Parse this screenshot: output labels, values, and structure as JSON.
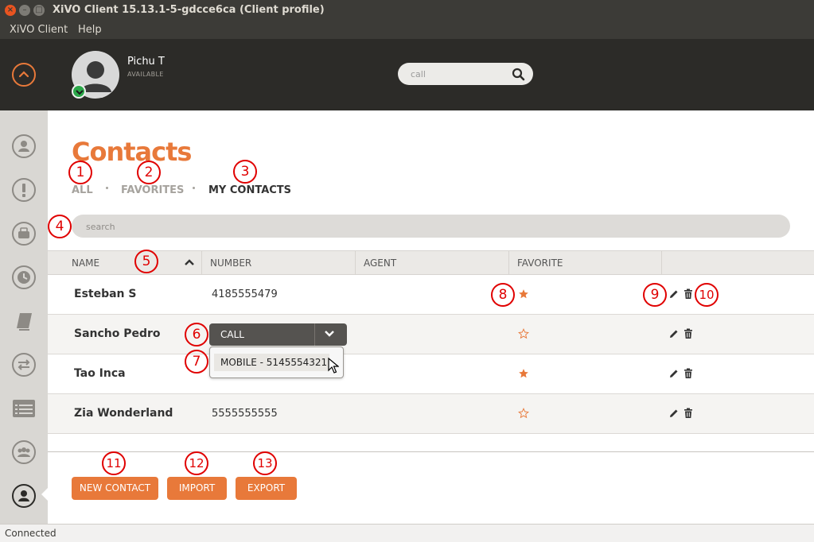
{
  "window": {
    "title": "XiVO Client 15.13.1-5-gdcce6ca (Client profile)",
    "menu": [
      "XiVO Client",
      "Help"
    ]
  },
  "header": {
    "user_name": "Pichu T",
    "user_status": "AVAILABLE",
    "call_placeholder": "call"
  },
  "contacts": {
    "title": "Contacts",
    "tabs": [
      "ALL",
      "FAVORITES",
      "MY CONTACTS"
    ],
    "search_placeholder": "search",
    "columns": [
      "NAME",
      "NUMBER",
      "AGENT",
      "FAVORITE"
    ],
    "rows": [
      {
        "name": "Esteban S",
        "number": "4185555479",
        "favorite": true
      },
      {
        "name": "Sancho Pedro",
        "number": "",
        "favorite": false
      },
      {
        "name": "Tao Inca",
        "number": "",
        "favorite": true
      },
      {
        "name": "Zia Wonderland",
        "number": "5555555555",
        "favorite": false
      }
    ],
    "call_button": "CALL",
    "call_option": "MOBILE - 5145554321",
    "buttons": [
      "NEW CONTACT",
      "IMPORT",
      "EXPORT"
    ]
  },
  "annotations": [
    "1",
    "2",
    "3",
    "4",
    "5",
    "6",
    "7",
    "8",
    "9",
    "10",
    "11",
    "12",
    "13"
  ],
  "status": "Connected",
  "colors": {
    "accent": "#e8793a",
    "header_bg": "#2c2b28",
    "presence": "#2ca84a"
  },
  "icons": [
    "collapse-up-icon",
    "search-icon",
    "user-icon",
    "alert-icon",
    "voicemail-icon",
    "history-icon",
    "directory-icon",
    "transfer-icon",
    "list-icon",
    "conference-icon",
    "contacts-icon",
    "star-icon",
    "edit-icon",
    "delete-icon",
    "sort-asc-icon",
    "chevron-down-icon"
  ]
}
